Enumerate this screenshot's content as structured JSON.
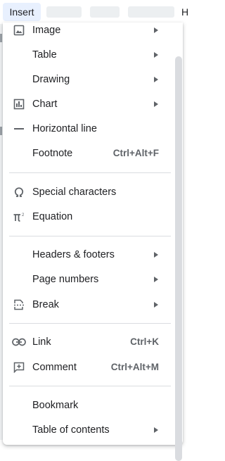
{
  "menubar": {
    "active_tab": "Insert",
    "edge_letter": "H"
  },
  "menu": {
    "items": [
      {
        "label": "Image",
        "icon": "image-icon",
        "submenu": true
      },
      {
        "label": "Table",
        "icon": "",
        "submenu": true
      },
      {
        "label": "Drawing",
        "icon": "",
        "submenu": true
      },
      {
        "label": "Chart",
        "icon": "chart-icon",
        "submenu": true
      },
      {
        "label": "Horizontal line",
        "icon": "horizontal-line-icon",
        "submenu": false
      },
      {
        "label": "Footnote",
        "icon": "",
        "shortcut": "Ctrl+Alt+F",
        "submenu": false
      },
      {
        "label": "Special characters",
        "icon": "omega-icon",
        "submenu": false
      },
      {
        "label": "Equation",
        "icon": "pi-icon",
        "submenu": false
      },
      {
        "label": "Headers & footers",
        "icon": "",
        "submenu": true
      },
      {
        "label": "Page numbers",
        "icon": "",
        "submenu": true
      },
      {
        "label": "Break",
        "icon": "page-break-icon",
        "submenu": true
      },
      {
        "label": "Link",
        "icon": "link-icon",
        "shortcut": "Ctrl+K",
        "submenu": false
      },
      {
        "label": "Comment",
        "icon": "add-comment-icon",
        "shortcut": "Ctrl+Alt+M",
        "submenu": false
      },
      {
        "label": "Bookmark",
        "icon": "",
        "submenu": false
      },
      {
        "label": "Table of contents",
        "icon": "",
        "submenu": true
      }
    ]
  },
  "colors": {
    "active_tab_bg": "#e8f0fe",
    "text": "#202124",
    "secondary_text": "#5f6368",
    "divider": "#dadce0"
  }
}
